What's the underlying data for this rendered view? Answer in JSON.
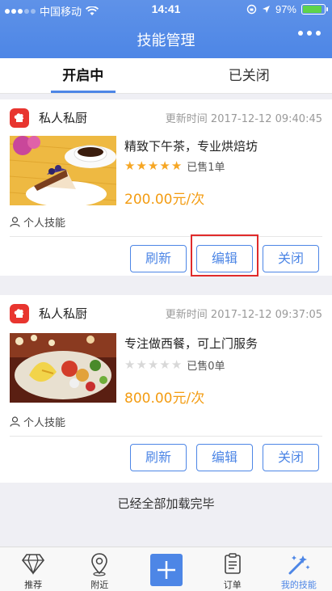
{
  "status_bar": {
    "carrier": "中国移动",
    "time": "14:41",
    "battery": "97%"
  },
  "header": {
    "title": "技能管理"
  },
  "tabs": [
    {
      "label": "开启中",
      "active": true
    },
    {
      "label": "已关闭",
      "active": false
    }
  ],
  "cards": [
    {
      "brand": "私人私厨",
      "update_time": "更新时间 2017-12-12 09:40:45",
      "title": "精致下午茶，专业烘焙坊",
      "rating": 5,
      "sold": "已售1单",
      "price": "200.00元/次",
      "type": "个人技能",
      "buttons": {
        "refresh": "刷新",
        "edit": "编辑",
        "close": "关闭"
      }
    },
    {
      "brand": "私人私厨",
      "update_time": "更新时间 2017-12-12 09:37:05",
      "title": "专注做西餐，可上门服务",
      "rating": 0,
      "sold": "已售0单",
      "price": "800.00元/次",
      "type": "个人技能",
      "buttons": {
        "refresh": "刷新",
        "edit": "编辑",
        "close": "关闭"
      }
    }
  ],
  "footer_text": "已经全部加载完毕",
  "bottom_nav": [
    {
      "label": "推荐",
      "icon": "diamond-icon"
    },
    {
      "label": "附近",
      "icon": "location-pin-icon"
    },
    {
      "label": "",
      "icon": "plus-icon"
    },
    {
      "label": "订单",
      "icon": "clipboard-icon"
    },
    {
      "label": "我的技能",
      "icon": "magic-wand-icon",
      "active": true
    }
  ],
  "colors": {
    "primary": "#4d86e6",
    "price": "#f39c12",
    "star": "#f6a623",
    "highlight": "#e02b2b",
    "brand_icon": "#e8352f"
  }
}
